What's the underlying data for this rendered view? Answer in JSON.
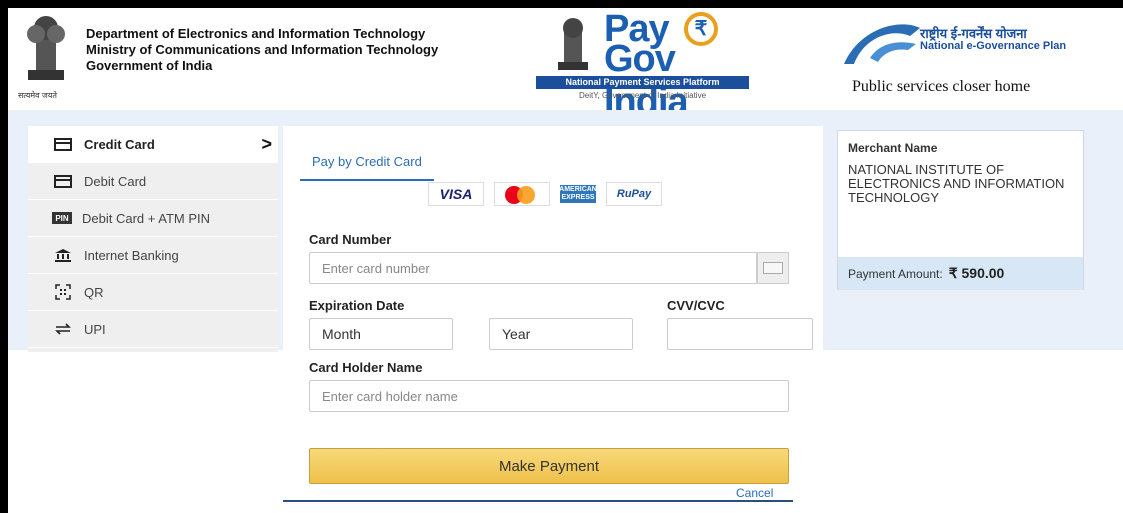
{
  "header": {
    "dept_lines": [
      "Department of Electronics and Information Technology",
      "Ministry of Communications and Information Technology",
      "Government of India"
    ],
    "emblem_caption": "सत्यमेव जयते",
    "paygov": {
      "pay": "Pay",
      "gov": "Gov India",
      "platform": "National Payment Services Platform",
      "initiative": "DeitY, Government of India Initiative"
    },
    "ngp": {
      "hindi": "राष्ट्रीय ई-गवर्नेंस योजना",
      "english": "National e-Governance Plan",
      "tagline": "Public services closer home"
    }
  },
  "sidebar": {
    "items": [
      {
        "label": "Credit Card",
        "icon": "card-icon",
        "active": true
      },
      {
        "label": "Debit Card",
        "icon": "card-icon",
        "active": false
      },
      {
        "label": "Debit Card + ATM PIN",
        "icon": "pin-icon",
        "active": false
      },
      {
        "label": "Internet Banking",
        "icon": "bank-icon",
        "active": false
      },
      {
        "label": "QR",
        "icon": "qr-icon",
        "active": false
      },
      {
        "label": "UPI",
        "icon": "upi-icon",
        "active": false
      }
    ],
    "pin_icon_text": "PIN"
  },
  "main": {
    "tab_label": "Pay by Credit Card",
    "card_brands": {
      "visa": "VISA",
      "amex": "AMERICAN EXPRESS",
      "rupay": "RuPay"
    },
    "card_number_label": "Card Number",
    "card_number_placeholder": "Enter card number",
    "expiry_label": "Expiration Date",
    "month_value": "Month",
    "year_value": "Year",
    "cvv_label": "CVV/CVC",
    "cvv_value": "",
    "holder_label": "Card Holder Name",
    "holder_placeholder": "Enter card holder name",
    "pay_button": "Make Payment",
    "cancel_link": "Cancel"
  },
  "merchant": {
    "name_label": "Merchant Name",
    "name_value": "NATIONAL INSTITUTE OF ELECTRONICS AND INFORMATION TECHNOLOGY",
    "amount_label": "Payment Amount:",
    "amount_value": "₹ 590.00"
  },
  "colors": {
    "accent_blue": "#2a6db5",
    "button_gold": "#efc04a",
    "band": "#eaf0fa"
  }
}
